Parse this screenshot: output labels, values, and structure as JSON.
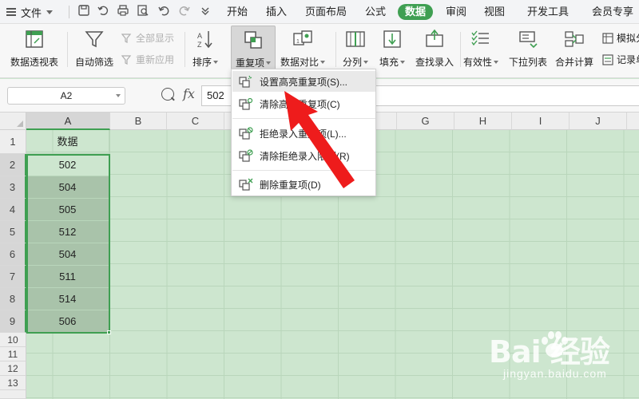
{
  "menubar": {
    "file_label": "文件",
    "tabs": [
      {
        "label": "开始",
        "active": false
      },
      {
        "label": "插入",
        "active": false
      },
      {
        "label": "页面布局",
        "active": false
      },
      {
        "label": "公式",
        "active": false
      },
      {
        "label": "数据",
        "active": true
      },
      {
        "label": "审阅",
        "active": false
      },
      {
        "label": "视图",
        "active": false
      },
      {
        "label": "开发工具",
        "active": false
      },
      {
        "label": "会员专享",
        "active": false
      }
    ],
    "quick_access_icons": [
      "save-icon",
      "undo-alt-icon",
      "print-icon",
      "print-preview-icon",
      "undo-icon",
      "redo-icon",
      "customize-icon"
    ]
  },
  "ribbon": {
    "pivot_table": "数据透视表",
    "auto_filter": "自动筛选",
    "show_all": "全部显示",
    "reapply": "重新应用",
    "sort": "排序",
    "duplicates": "重复项",
    "compare": "数据对比",
    "split_column": "分列",
    "fill": "填充",
    "lookup_entry": "查找录入",
    "validity": "有效性",
    "dropdown_list": "下拉列表",
    "consolidate": "合并计算",
    "simulate": "模拟分",
    "record": "记录单"
  },
  "formula_bar": {
    "name_box": "A2",
    "fx_label": "fx",
    "formula": "502"
  },
  "grid": {
    "columns": [
      "A",
      "B",
      "C",
      "D",
      "E",
      "F",
      "G",
      "H",
      "I",
      "J"
    ],
    "rows": [
      "1",
      "2",
      "3",
      "4",
      "5",
      "6",
      "7",
      "8",
      "9",
      "10",
      "11",
      "12",
      "13"
    ],
    "column_a": [
      "数据",
      "502",
      "504",
      "505",
      "512",
      "504",
      "511",
      "514",
      "506"
    ]
  },
  "dropdown": {
    "items": [
      "设置高亮重复项(S)...",
      "清除高亮重复项(C)",
      "拒绝录入重复项(L)...",
      "清除拒绝录入限制(R)",
      "删除重复项(D)"
    ]
  },
  "watermark": {
    "brand": "Bai 经验",
    "url": "jingyan.baidu.com"
  },
  "colors": {
    "accent": "#3f9f52",
    "grid_bg": "#cde6cf",
    "selection": "#a9c3aa",
    "arrow": "#ee1c1c"
  }
}
